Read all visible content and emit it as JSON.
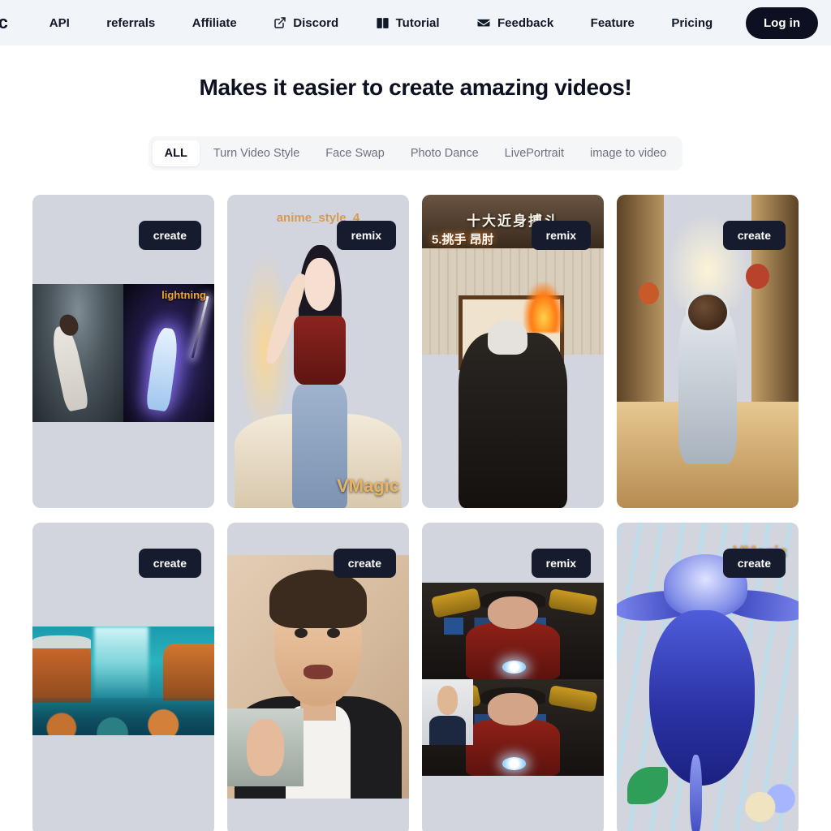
{
  "navbar": {
    "logo": "ic",
    "links": [
      {
        "label": "API",
        "icon": null
      },
      {
        "label": "referrals",
        "icon": null
      },
      {
        "label": "Affiliate",
        "icon": null
      },
      {
        "label": "Discord",
        "icon": "external-link-icon"
      },
      {
        "label": "Tutorial",
        "icon": "book-icon"
      },
      {
        "label": "Feedback",
        "icon": "envelope-icon"
      },
      {
        "label": "Feature",
        "icon": null
      },
      {
        "label": "Pricing",
        "icon": null
      }
    ],
    "login_label": "Log in",
    "background": "#f1f4f9",
    "accent": "#0d1020"
  },
  "headline": "Makes it easier to create amazing videos!",
  "filters": {
    "active": "ALL",
    "tabs": [
      "ALL",
      "Turn Video Style",
      "Face Swap",
      "Photo Dance",
      "LivePortrait",
      "image to video"
    ]
  },
  "gallery": {
    "cards": [
      {
        "id": "card-dance-lightning",
        "action": "create",
        "overlay_label": "lightning",
        "watermark": null
      },
      {
        "id": "card-anime-style-4",
        "action": "remix",
        "overlay_label": "anime_style_4",
        "watermark": "VMagic"
      },
      {
        "id": "card-kungfu",
        "action": "remix",
        "overlay_label": "十大近身搏斗",
        "overlay_label_2": "5.挑手 昂肘",
        "watermark": null
      },
      {
        "id": "card-astronaut",
        "action": "create",
        "overlay_label": null,
        "watermark": null
      },
      {
        "id": "card-underwater-city",
        "action": "create",
        "overlay_label": null,
        "watermark": null
      },
      {
        "id": "card-portrait-faceswap",
        "action": "create",
        "overlay_label": null,
        "watermark": null
      },
      {
        "id": "card-ironman-faceswap",
        "action": "remix",
        "overlay_label": null,
        "watermark": null
      },
      {
        "id": "card-blue-flower",
        "action": "create",
        "overlay_label": null,
        "watermark": "VMagic"
      }
    ]
  }
}
